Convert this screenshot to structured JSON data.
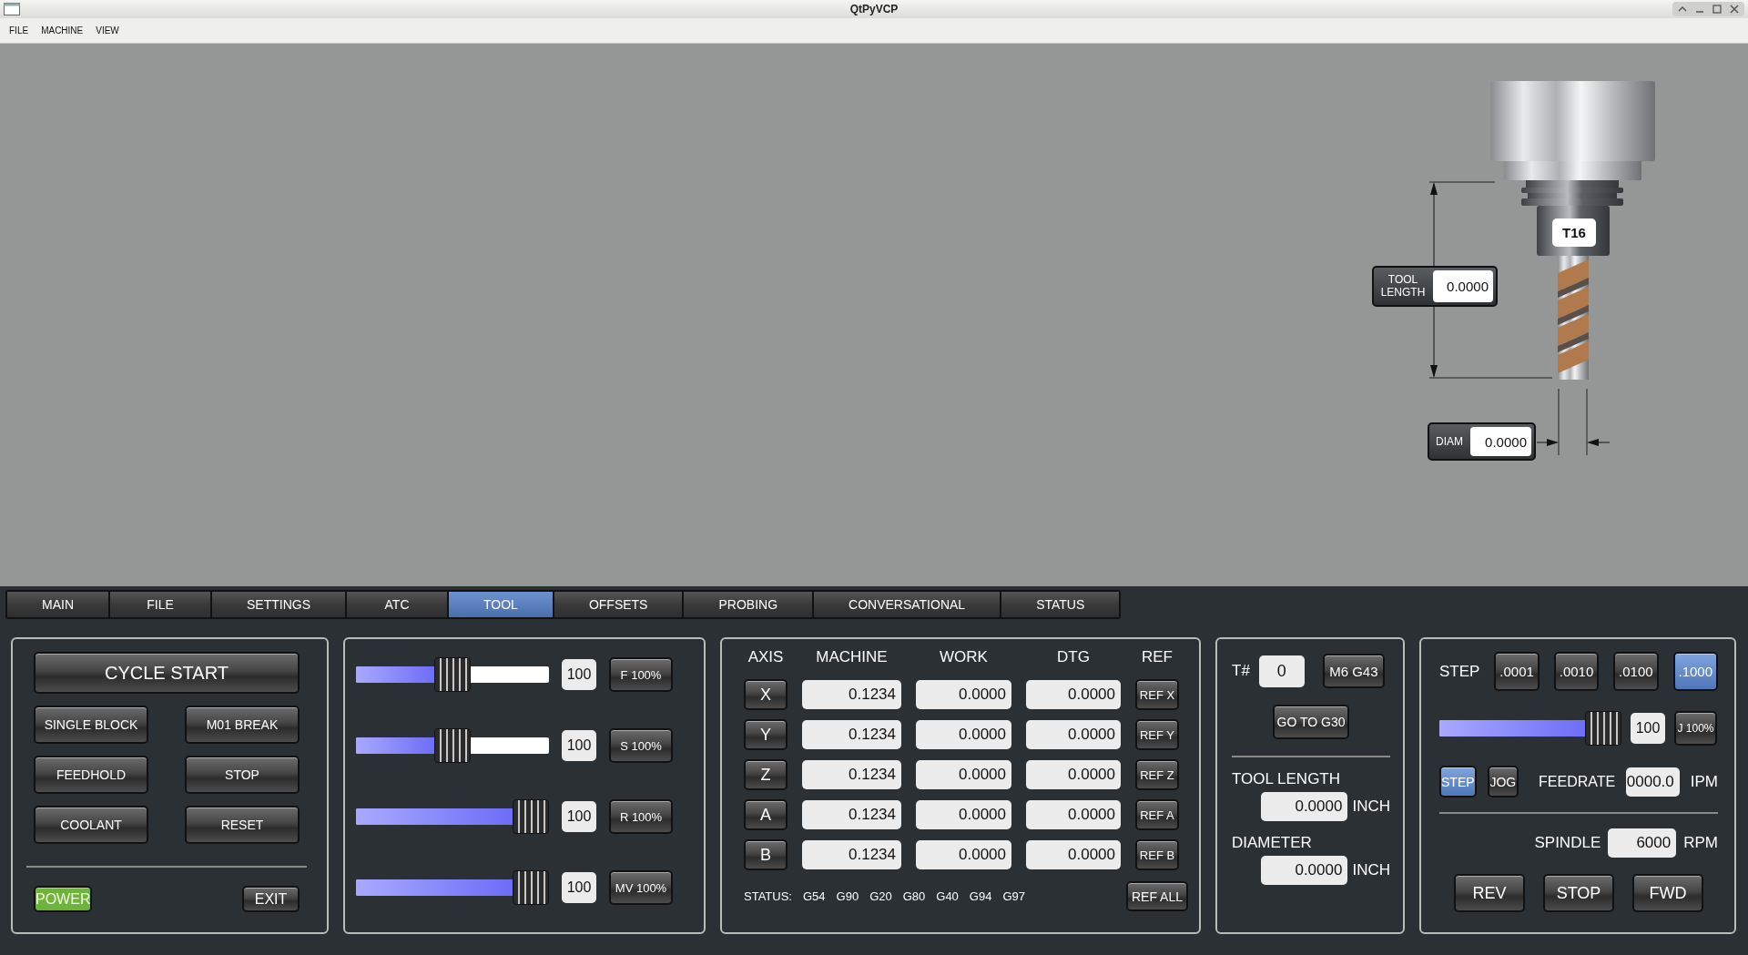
{
  "window": {
    "title": "QtPyVCP"
  },
  "menu": [
    "FILE",
    "MACHINE",
    "VIEW"
  ],
  "tool_preview": {
    "tool_label": "T16",
    "tool_length": {
      "label": "TOOL LENGTH",
      "value": "0.0000"
    },
    "diam": {
      "label": "DIAM",
      "value": "0.0000"
    }
  },
  "tabs": [
    {
      "label": "MAIN",
      "selected": false
    },
    {
      "label": "FILE",
      "selected": false
    },
    {
      "label": "SETTINGS",
      "selected": false
    },
    {
      "label": "ATC",
      "selected": false
    },
    {
      "label": "TOOL",
      "selected": true
    },
    {
      "label": "OFFSETS",
      "selected": false
    },
    {
      "label": "PROBING",
      "selected": false
    },
    {
      "label": "CONVERSATIONAL",
      "selected": false
    },
    {
      "label": "STATUS",
      "selected": false
    }
  ],
  "program_panel": {
    "cycle_start": "CYCLE START",
    "buttons": [
      "SINGLE BLOCK",
      "M01 BREAK",
      "FEEDHOLD",
      "STOP",
      "COOLANT",
      "RESET"
    ],
    "power": {
      "label": "POWER",
      "on": true
    },
    "exit": "EXIT"
  },
  "overrides": [
    {
      "level": 0.5,
      "value": "100",
      "button": "F 100%"
    },
    {
      "level": 0.5,
      "value": "100",
      "button": "S 100%"
    },
    {
      "level": 1,
      "value": "100",
      "button": "R 100%"
    },
    {
      "level": 1,
      "value": "100",
      "button": "MV 100%"
    }
  ],
  "dro": {
    "columns": [
      "AXIS",
      "MACHINE",
      "WORK",
      "DTG",
      "REF"
    ],
    "rows": [
      {
        "axis": "X",
        "machine": "0.1234",
        "work": "0.0000",
        "dtg": "0.0000",
        "ref": "REF X"
      },
      {
        "axis": "Y",
        "machine": "0.1234",
        "work": "0.0000",
        "dtg": "0.0000",
        "ref": "REF Y"
      },
      {
        "axis": "Z",
        "machine": "0.1234",
        "work": "0.0000",
        "dtg": "0.0000",
        "ref": "REF Z"
      },
      {
        "axis": "A",
        "machine": "0.1234",
        "work": "0.0000",
        "dtg": "0.0000",
        "ref": "REF A"
      },
      {
        "axis": "B",
        "machine": "0.1234",
        "work": "0.0000",
        "dtg": "0.0000",
        "ref": "REF B"
      }
    ],
    "status_label": "STATUS:",
    "status_codes": [
      "G54",
      "G90",
      "G20",
      "G80",
      "G40",
      "G94",
      "G97"
    ],
    "ref_all": "REF ALL"
  },
  "tool_panel": {
    "tnum_label": "T#",
    "tnum": "0",
    "m6": "M6 G43",
    "g30": "GO TO G30",
    "tool_length": {
      "label": "TOOL LENGTH",
      "value": "0.0000",
      "unit": "INCH"
    },
    "diameter": {
      "label": "DIAMETER",
      "value": "0.0000",
      "unit": "INCH"
    }
  },
  "jog_panel": {
    "step_label": "STEP",
    "steps": [
      {
        "label": ".0001",
        "selected": false
      },
      {
        "label": ".0010",
        "selected": false
      },
      {
        "label": ".0100",
        "selected": false
      },
      {
        "label": ".1000",
        "selected": true
      }
    ],
    "jog_slider": {
      "level": 1
    },
    "jog_value": "100",
    "jog_button": "J 100%",
    "modes": [
      {
        "label": "STEP",
        "selected": true
      },
      {
        "label": "JOG",
        "selected": false
      }
    ],
    "feedrate": {
      "label": "FEEDRATE",
      "value": "0000.0",
      "unit": "IPM"
    },
    "spindle": {
      "label": "SPINDLE",
      "value": "6000",
      "unit": "RPM"
    },
    "spindle_buttons": [
      "REV",
      "STOP",
      "FWD"
    ]
  }
}
